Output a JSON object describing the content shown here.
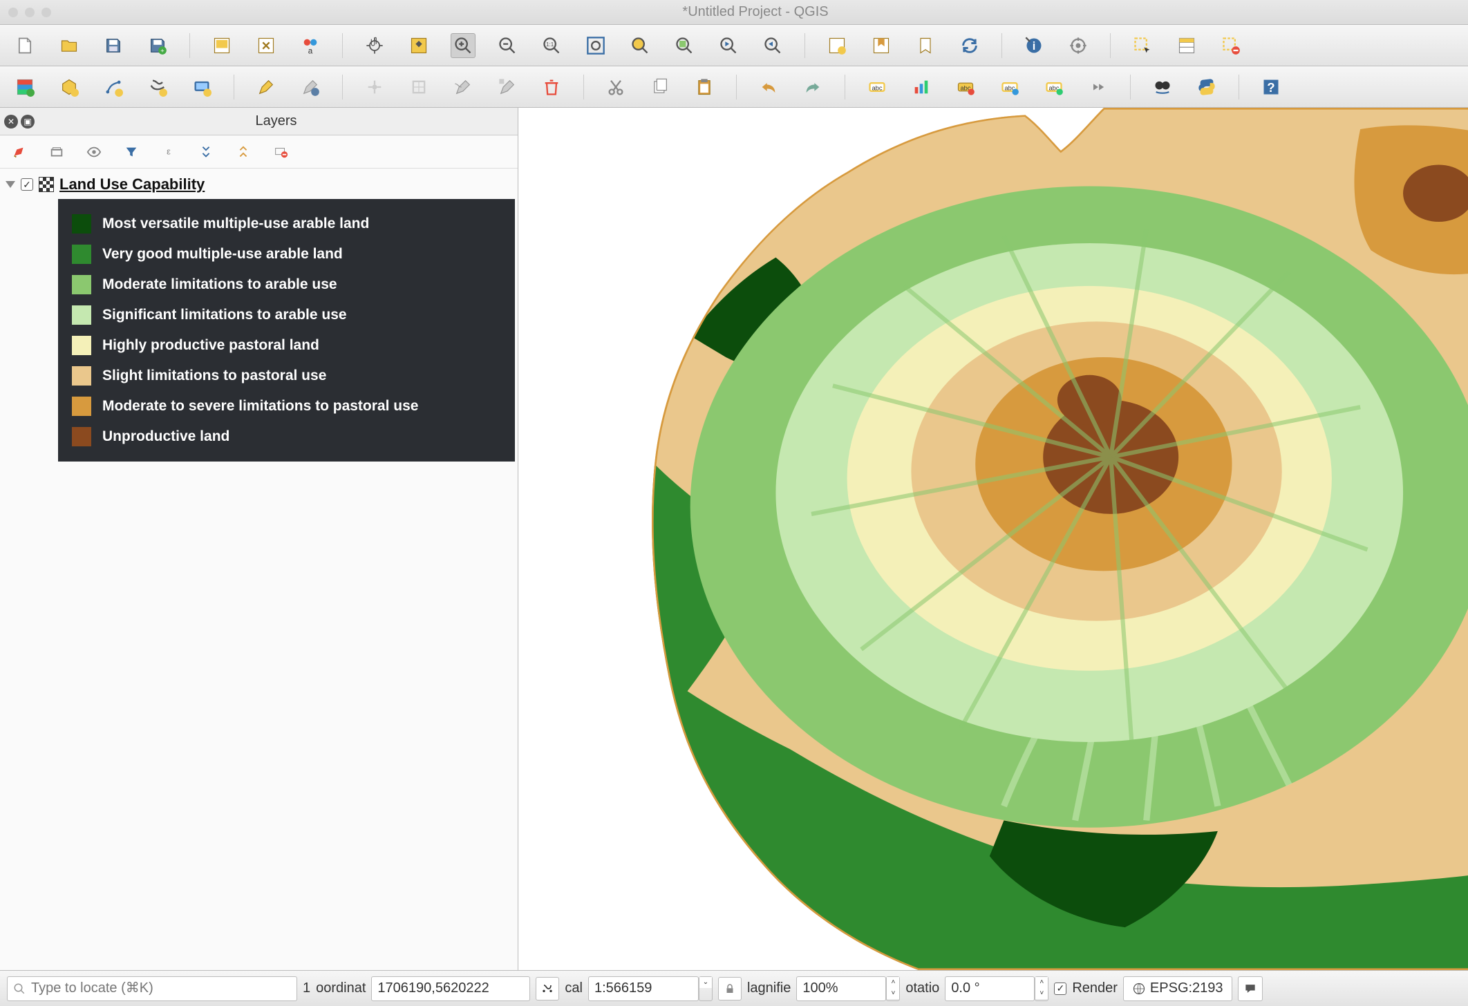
{
  "window": {
    "title": "*Untitled Project - QGIS"
  },
  "layers_panel": {
    "title": "Layers"
  },
  "layer": {
    "name": "Land Use Capability",
    "visible": true,
    "legend": [
      {
        "color": "#0c4d0c",
        "label": "Most versatile multiple-use arable land"
      },
      {
        "color": "#2f8a2f",
        "label": "Very good multiple-use arable land"
      },
      {
        "color": "#8bc86f",
        "label": "Moderate limitations to arable use"
      },
      {
        "color": "#c5e8b0",
        "label": "Significant limitations to arable use"
      },
      {
        "color": "#f4f0b8",
        "label": "Highly productive pastoral land"
      },
      {
        "color": "#eac78c",
        "label": "Slight limitations to pastoral use"
      },
      {
        "color": "#d79a3e",
        "label": "Moderate to severe limitations to pastoral use"
      },
      {
        "color": "#8b4a1f",
        "label": "Unproductive land"
      }
    ]
  },
  "status": {
    "locator_placeholder": "Type to locate (⌘K)",
    "progress": "1",
    "coord_label": "oordinat",
    "coord_value": "1706190,5620222",
    "scale_label": "cal",
    "scale_value": "1:566159",
    "magnifier_label": "lagnifie",
    "magnifier_value": "100%",
    "rotation_label": "otatio",
    "rotation_value": "0.0 °",
    "render_label": "Render",
    "crs": "EPSG:2193"
  },
  "colors": {
    "c1": "#0c4d0c",
    "c2": "#2f8a2f",
    "c3": "#8bc86f",
    "c4": "#c5e8b0",
    "c5": "#f4f0b8",
    "c6": "#eac78c",
    "c7": "#d79a3e",
    "c8": "#8b4a1f"
  }
}
